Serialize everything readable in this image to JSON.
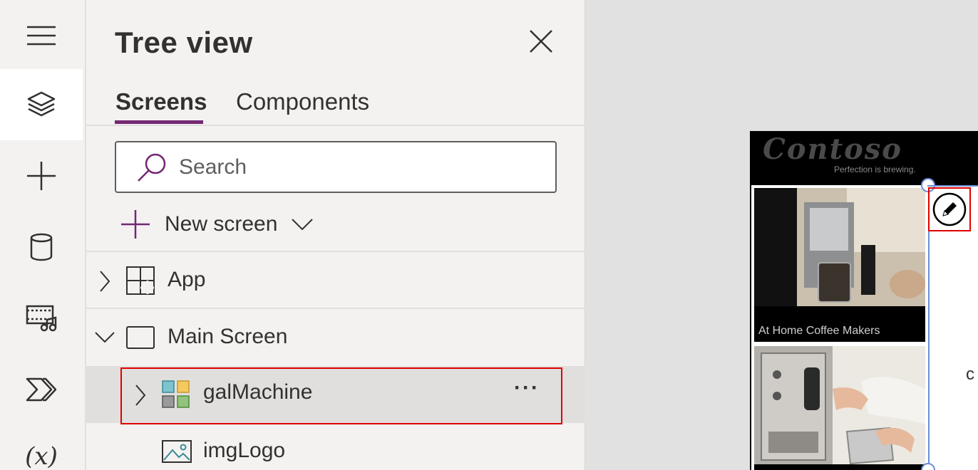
{
  "rail": {
    "items": [
      {
        "icon": "hamburger-menu-icon"
      },
      {
        "icon": "layers-icon",
        "active": true
      },
      {
        "icon": "plus-icon"
      },
      {
        "icon": "database-icon"
      },
      {
        "icon": "media-icon"
      },
      {
        "icon": "power-automate-icon"
      },
      {
        "icon": "variables-icon",
        "label": "(x)"
      }
    ]
  },
  "panel": {
    "title": "Tree view",
    "tabs": [
      "Screens",
      "Components"
    ],
    "active_tab": "Screens",
    "search": {
      "placeholder": "Search",
      "value": ""
    },
    "new_screen_label": "New screen",
    "tree": [
      {
        "label": "App",
        "icon": "app-icon",
        "expandable": true,
        "expanded": false
      },
      {
        "label": "Main Screen",
        "icon": "screen-icon",
        "expandable": true,
        "expanded": true
      },
      {
        "label": "galMachine",
        "icon": "gallery-icon",
        "expandable": true,
        "expanded": false,
        "selected": true,
        "more": "···"
      },
      {
        "label": "imgLogo",
        "icon": "image-icon",
        "expandable": false
      }
    ]
  },
  "canvas": {
    "logo_text": "Contoso",
    "logo_tagline": "Perfection is brewing.",
    "cards": [
      {
        "label": "At Home Coffee Makers"
      },
      {
        "label": ""
      }
    ],
    "peek_text": "c"
  },
  "colors": {
    "accent": "#742774",
    "highlight": "#e00000",
    "selection_handle": "#6a8fd6"
  }
}
